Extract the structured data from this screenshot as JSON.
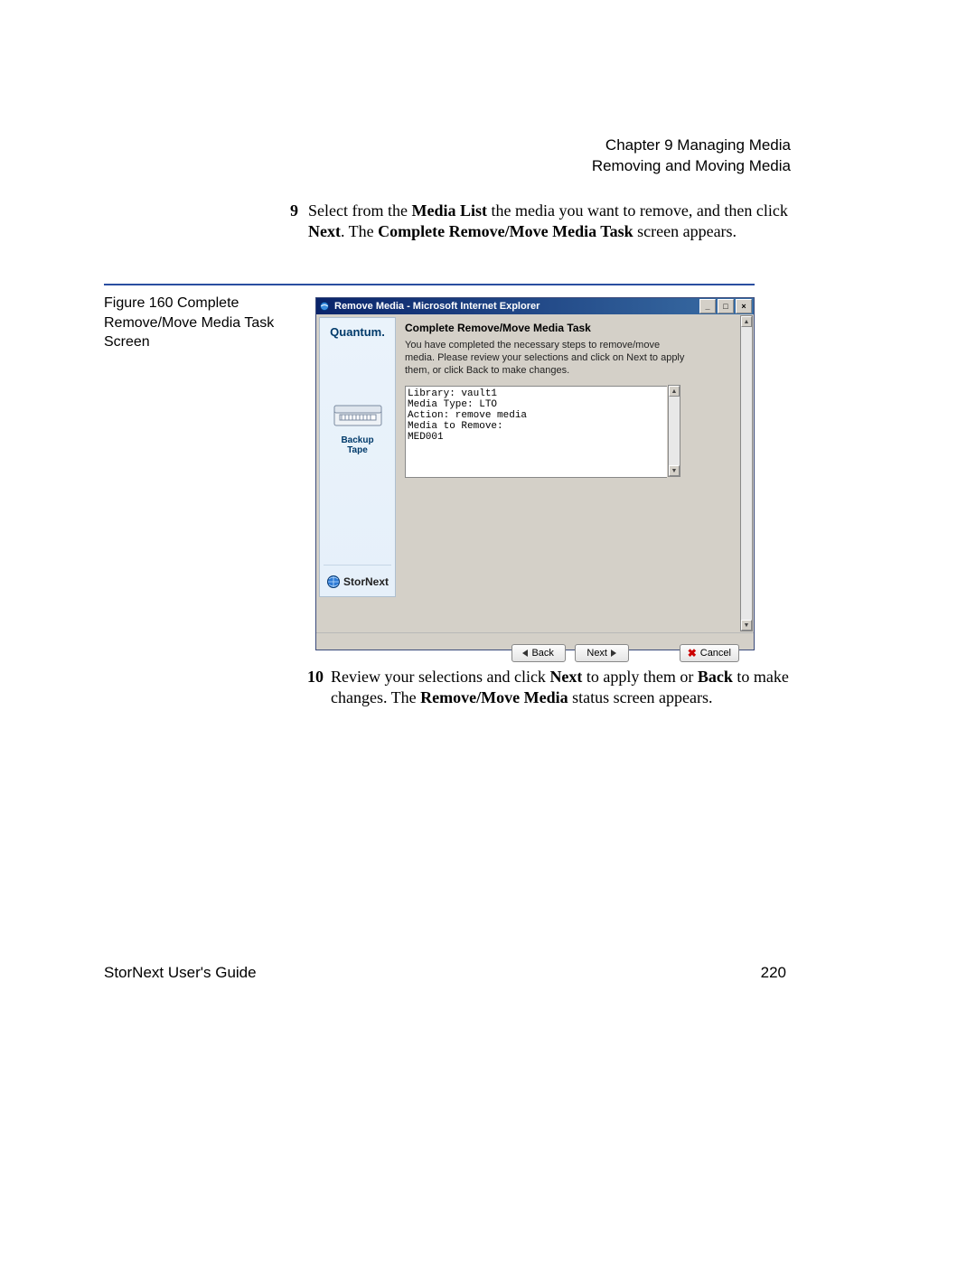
{
  "header": {
    "chapter": "Chapter 9  Managing Media",
    "section": "Removing and Moving Media"
  },
  "step9": {
    "num": "9",
    "pre": "Select from the ",
    "b1": "Media List",
    "mid1": " the media you want to remove, and then click ",
    "b2": "Next",
    "mid2": ". The ",
    "b3": "Complete Remove/Move Media Task",
    "post": " screen appears."
  },
  "figure": {
    "label": "Figure 160  Complete Remove/Move Media Task Screen"
  },
  "window": {
    "title": "Remove Media - Microsoft Internet Explorer",
    "controls": {
      "min": "_",
      "max": "□",
      "close": "×"
    },
    "sidebar": {
      "brand": "Quantum.",
      "tape_label": "Backup Tape",
      "product": "StorNext"
    },
    "task": {
      "heading": "Complete Remove/Move Media Task",
      "description": "You have completed the necessary steps to remove/move media. Please review your selections and click on Next to apply them, or click Back to make changes.",
      "summary": "Library: vault1\nMedia Type: LTO\nAction: remove media\nMedia to Remove:\nMED001"
    },
    "buttons": {
      "back": "Back",
      "next": "Next",
      "cancel": "Cancel"
    }
  },
  "step10": {
    "num": "10",
    "pre": "Review your selections and click ",
    "b1": "Next",
    "mid1": " to apply them or ",
    "b2": "Back",
    "mid2": " to make changes. The ",
    "b3": "Remove/Move Media",
    "post": " status screen appears."
  },
  "footer": {
    "left": "StorNext User's Guide",
    "right": "220"
  }
}
